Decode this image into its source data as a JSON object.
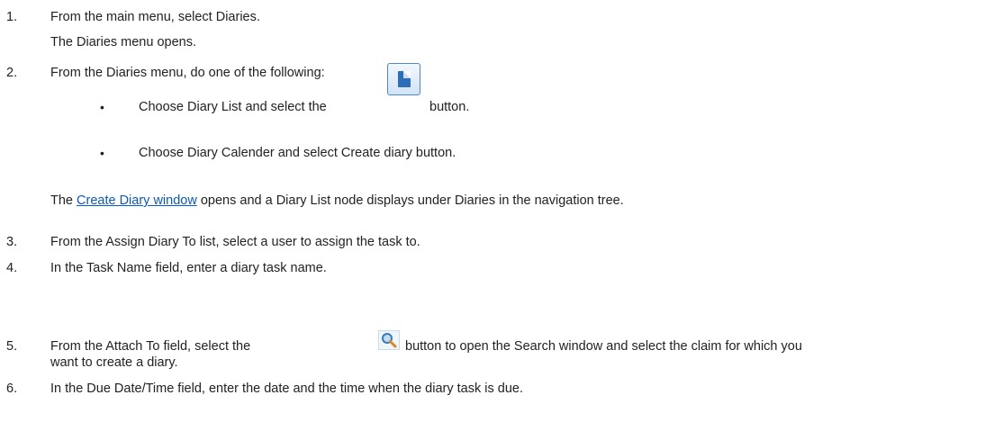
{
  "steps": [
    {
      "number": "1.",
      "text": "From the main menu, select Diaries.",
      "result": "The Diaries menu opens."
    },
    {
      "number": "2.",
      "text": "From the Diaries menu, do one of the following:",
      "options": [
        {
          "before": "Choose Diary List and select the",
          "after": "button."
        },
        {
          "text": "Choose Diary Calender and select Create diary button."
        }
      ],
      "result_prefix": "The",
      "result_link": "Create Diary window",
      "result_suffix": "opens and a Diary List node displays under Diaries in the navigation tree."
    },
    {
      "number": "3.",
      "text": "From the Assign Diary To list, select a user to assign the task to."
    },
    {
      "number": "4.",
      "text": "In the Task Name field, enter a diary task name."
    },
    {
      "number": "5.",
      "before": "From the Attach To field, select the",
      "after": "button to open the Search window and select the claim for which you",
      "continuation": "want to create a diary."
    },
    {
      "number": "6.",
      "text": "In the Due Date/Time field, enter the date and the time when the diary task is due."
    }
  ],
  "bullet_glyph": "•",
  "icons": {
    "new_diary": "new-document-icon",
    "search": "magnifier-search-icon"
  },
  "colors": {
    "text": "#222222",
    "link": "#0b57d0",
    "icon_blue": "#2c6eb8"
  }
}
